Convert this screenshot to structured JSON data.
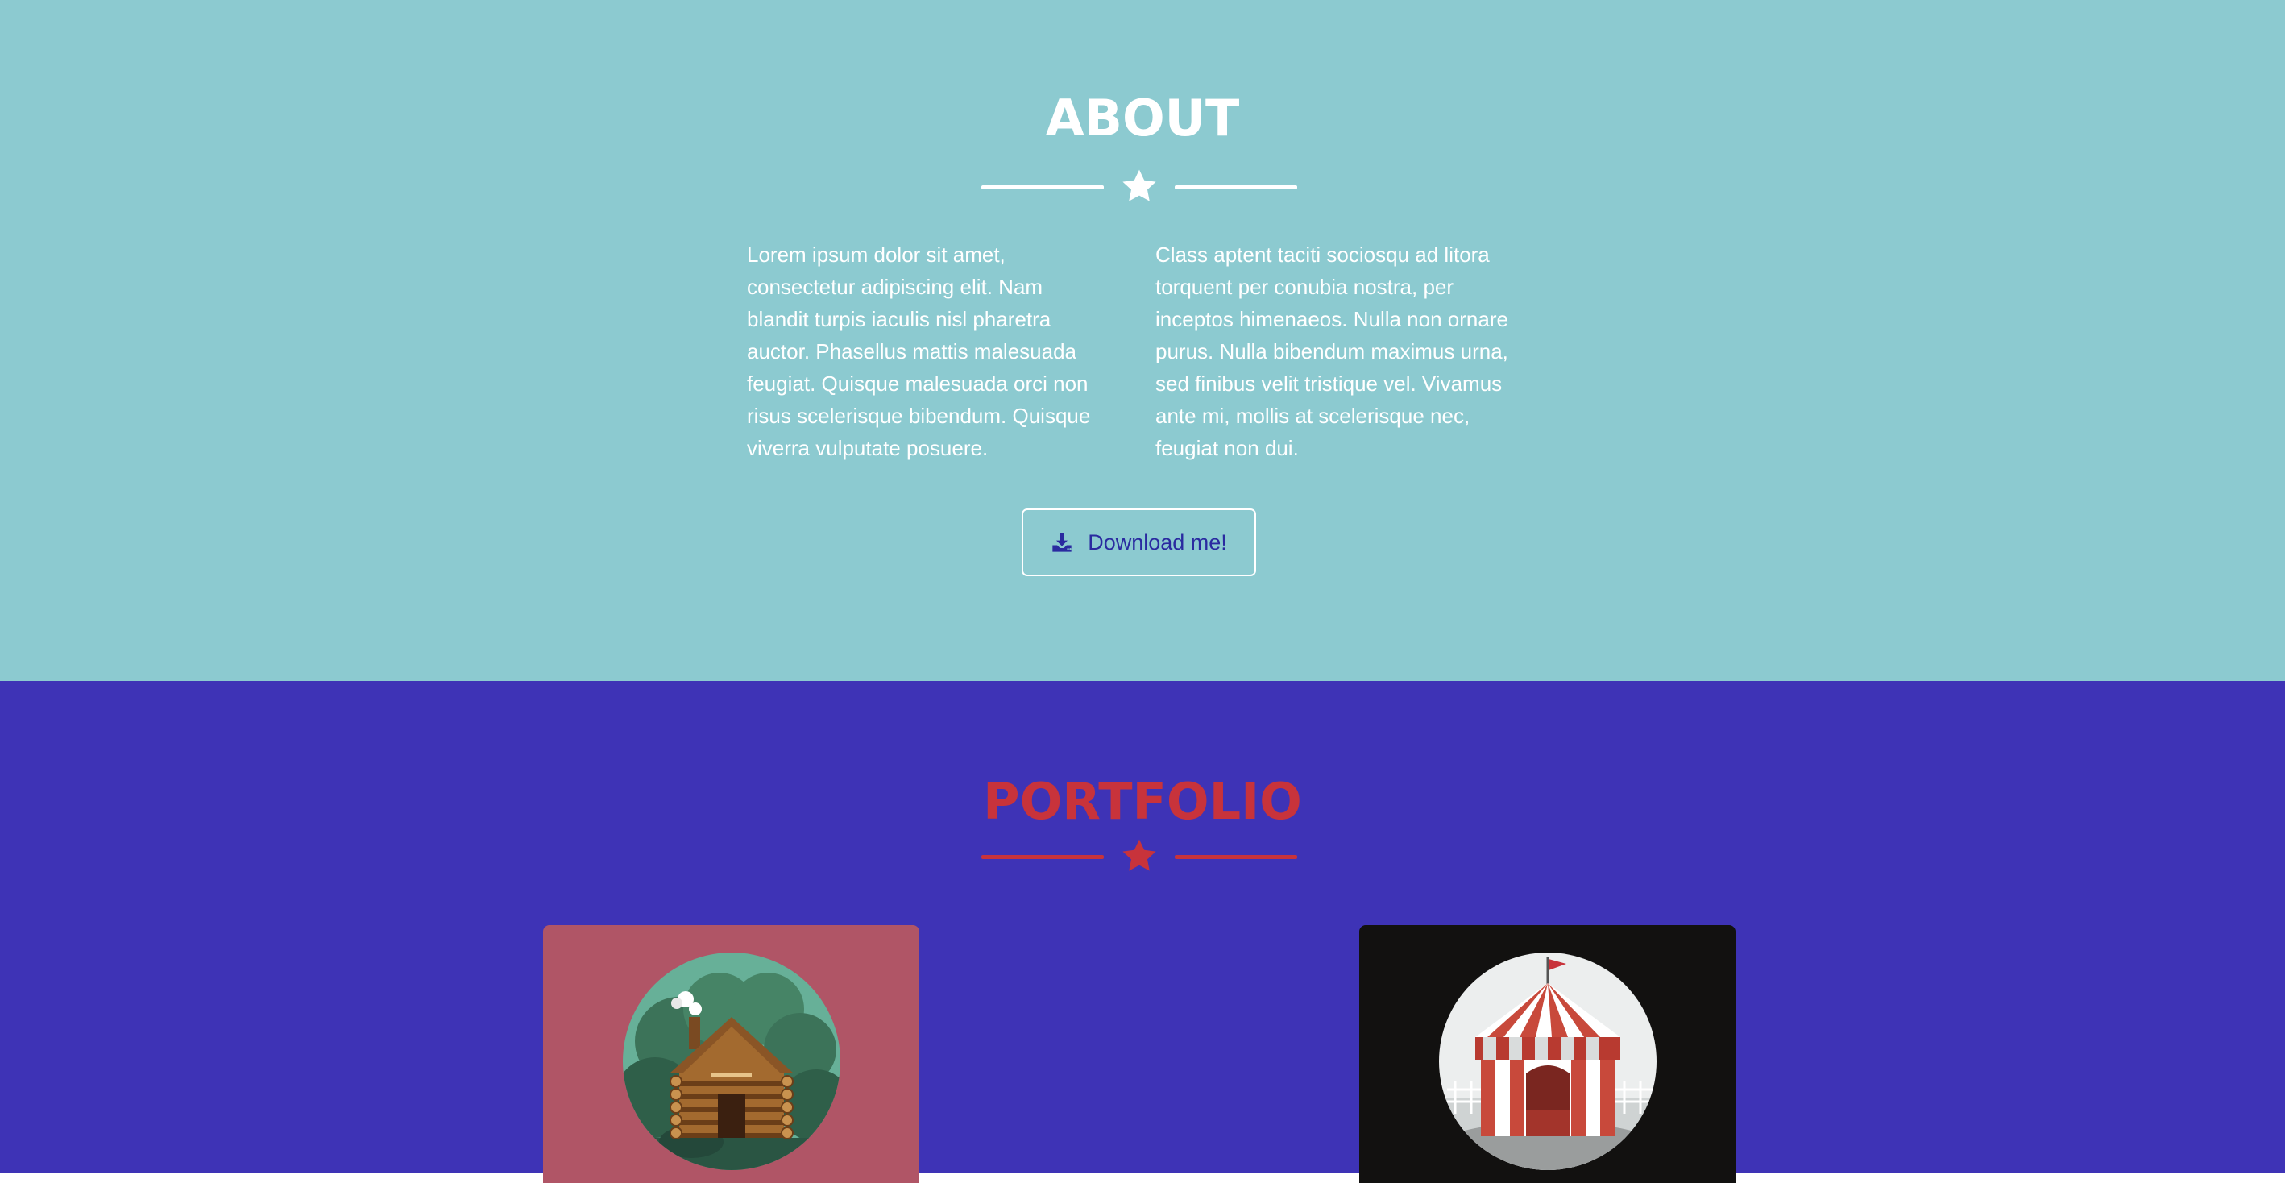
{
  "about": {
    "title": "ABOUT",
    "paragraph_left": "Lorem ipsum dolor sit amet, consectetur adipiscing elit. Nam blandit turpis iaculis nisl pharetra auctor. Phasellus mattis malesuada feugiat. Quisque malesuada orci non risus scelerisque bibendum. Quisque viverra vulputate posuere.",
    "paragraph_right": "Class aptent taciti sociosqu ad litora torquent per conubia nostra, per inceptos himenaeos. Nulla non ornare purus. Nulla bibendum maximus urna, sed finibus velit tristique vel. Vivamus ante mi, mollis at scelerisque nec, feugiat non dui.",
    "download_label": "Download me!",
    "download_icon": "download-icon",
    "divider_icon": "star-icon"
  },
  "portfolio": {
    "title": "PORTFOLIO",
    "divider_icon": "star-icon",
    "items": [
      {
        "icon": "log-cabin-icon",
        "card_color": "#b05566"
      },
      {
        "icon": "circus-tent-icon",
        "card_color": "#121110"
      }
    ]
  },
  "colors": {
    "about_bg": "#8ccad0",
    "portfolio_bg": "#3e33b6",
    "portfolio_accent": "#c8333b",
    "button_text": "#2a2aa0",
    "white": "#ffffff"
  }
}
